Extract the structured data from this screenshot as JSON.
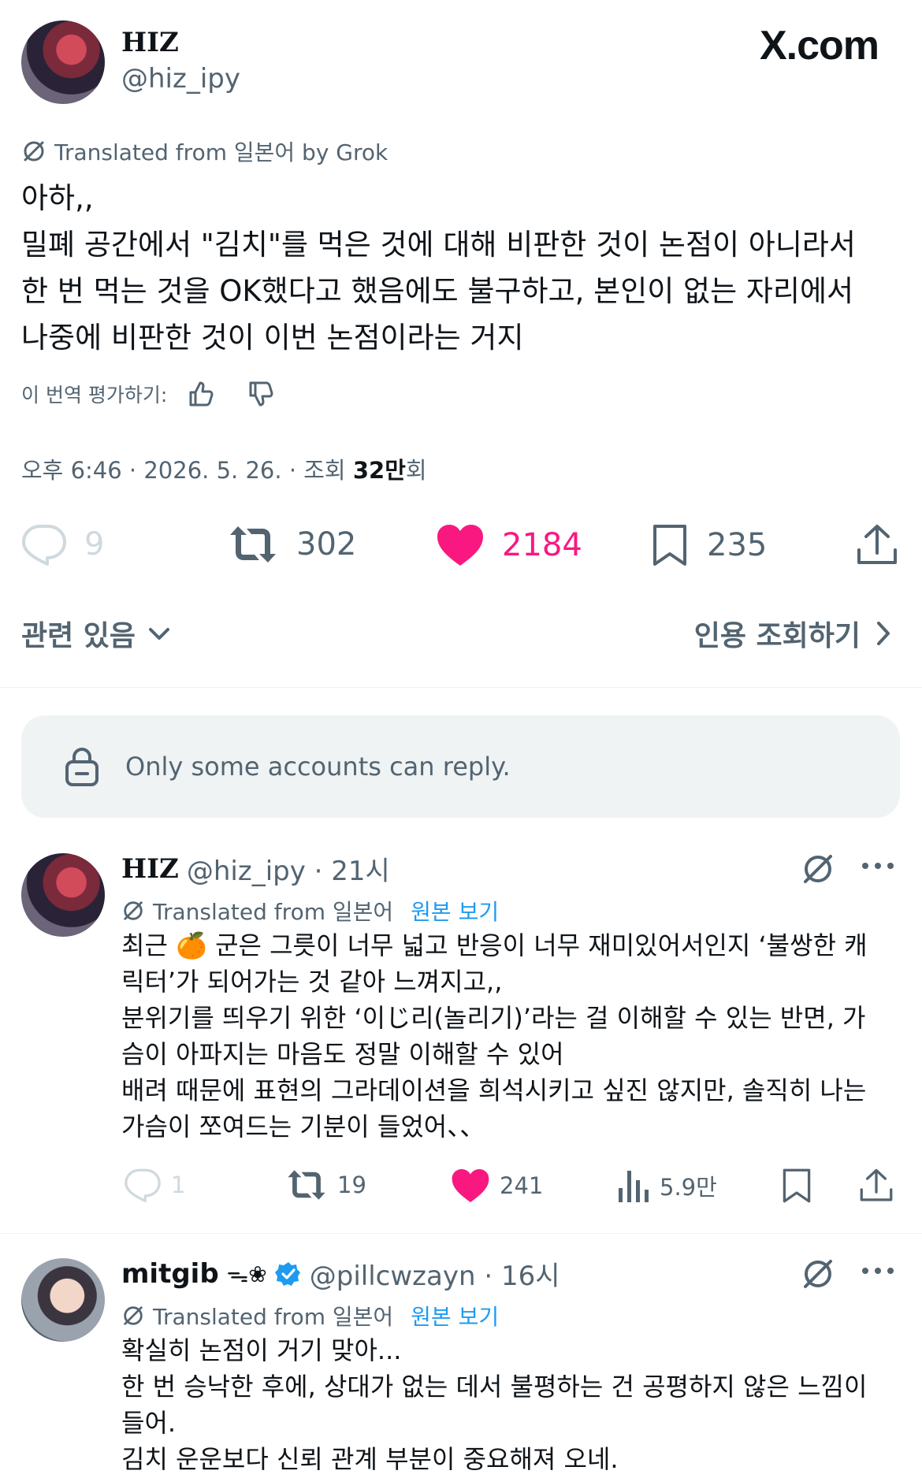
{
  "brand": "X.com",
  "main_tweet": {
    "author_name": "HIZ",
    "author_handle": "@hiz_ipy",
    "translated_label": "Translated from 일본어 by Grok",
    "text": "아하,,\n밀폐 공간에서 \"김치\"를 먹은 것에 대해 비판한 것이 논점이 아니라서\n한 번 먹는 것을 OK했다고 했음에도 불구하고, 본인이 없는 자리에서\n나중에 비판한 것이 이번 논점이라는 거지",
    "rate_label": "이 번역 평가하기:",
    "meta_prefix": "오후 6:46 · 2026. 5. 26. · 조회 ",
    "meta_views": "32만",
    "meta_suffix": "회",
    "replies": "9",
    "retweets": "302",
    "likes": "2184",
    "bookmarks": "235",
    "related_label": "관련 있음",
    "quotes_label": "인용 조회하기"
  },
  "reply_restriction": "Only some accounts can reply.",
  "replies": [
    {
      "name": "HIZ",
      "handle": "@hiz_ipy · 21시",
      "translated_label": "Translated from 일본어",
      "view_original": "원본 보기",
      "text": "최근 🍊 군은 그릇이 너무 넓고 반응이 너무 재미있어서인지 ‘불쌍한 캐\n릭터’가 되어가는 것 같아 느껴지고,,\n분위기를 띄우기 위한 ‘이じ리(놀리기)’라는 걸 이해할 수 있는 반면, 가\n슴이 아파지는 마음도 정말 이해할 수 있어\n배려 때문에 표현의 그라데이션을 희석시키고 싶진 않지만, 솔직히 나는\n가슴이 쪼여드는 기분이 들었어、、",
      "replies": "1",
      "retweets": "19",
      "likes": "241",
      "views": "5.9만"
    },
    {
      "name": "mitgib",
      "name_suffix": "ᯓ❀",
      "handle": "@pillcwzayn · 16시",
      "translated_label": "Translated from 일본어",
      "view_original": "원본 보기",
      "text": "확실히 논점이 거기 맞아...\n한 번 승낙한 후에, 상대가 없는 데서 불평하는 건 공평하지 않은 느낌이\n들어.\n김치 운운보다 신뢰 관계 부분이 중요해져 오네."
    }
  ],
  "colors": {
    "like": "#f91880",
    "link": "#1d9bf0",
    "verified": "#1d9bf0",
    "muted": "#536471"
  }
}
